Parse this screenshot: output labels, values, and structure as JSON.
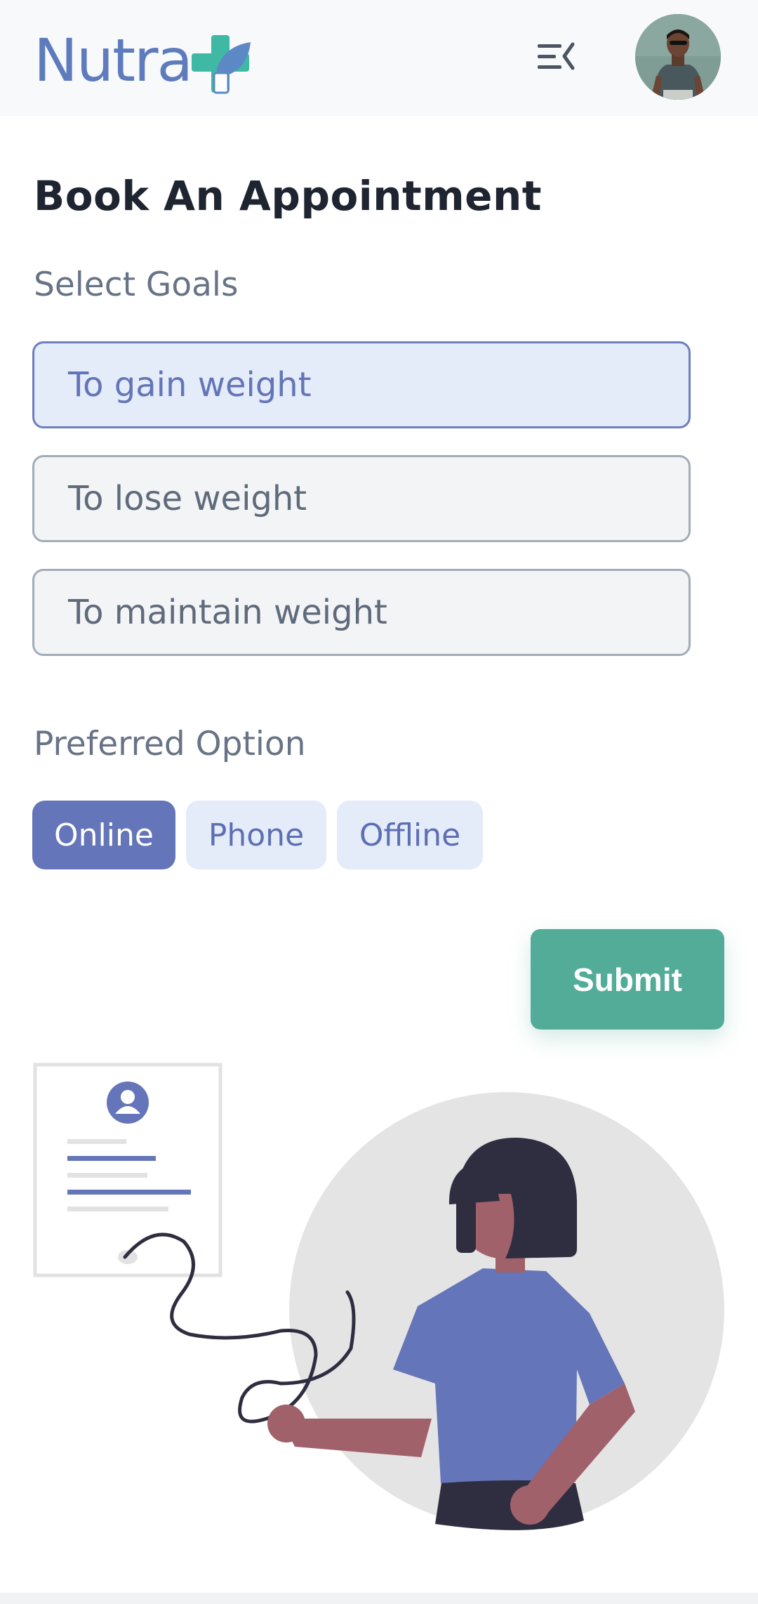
{
  "header": {
    "logo_text": "Nutra",
    "menu_icon": "menu-collapse-icon",
    "avatar_icon": "user-avatar"
  },
  "page": {
    "title": "Book An Appointment"
  },
  "goals": {
    "label": "Select Goals",
    "options": [
      "To gain weight",
      "To lose weight",
      "To maintain weight"
    ],
    "selected": "To gain weight"
  },
  "preferred": {
    "label": "Preferred Option",
    "options": [
      "Online",
      "Phone",
      "Offline"
    ],
    "selected": "Online"
  },
  "actions": {
    "submit_label": "Submit"
  },
  "colors": {
    "brand_blue": "#5d7bbd",
    "brand_green": "#52ac97",
    "accent": "#6475b9",
    "selected_bg": "#e4ebf9"
  }
}
